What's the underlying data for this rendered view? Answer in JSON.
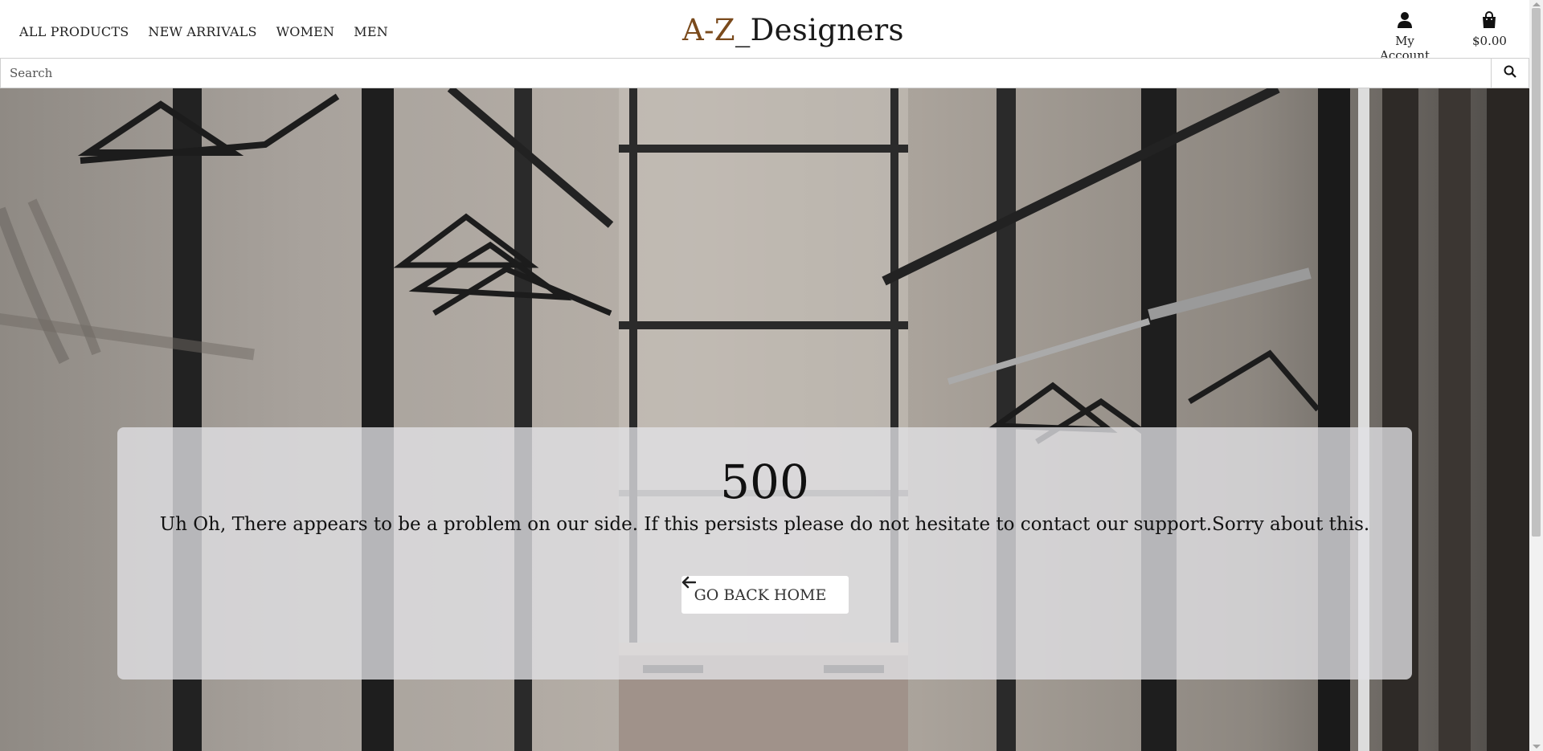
{
  "nav": {
    "items": [
      "ALL PRODUCTS",
      "NEW ARRIVALS",
      "WOMEN",
      "MEN"
    ]
  },
  "brand": {
    "part1": "A-Z",
    "part2": "_Designers"
  },
  "account": {
    "label": "My Account",
    "icon": "user-icon"
  },
  "cart": {
    "total": "$0.00",
    "icon": "shopping-bag-icon"
  },
  "search": {
    "placeholder": "Search",
    "value": "",
    "icon": "search-icon"
  },
  "error": {
    "code": "500",
    "message": "Uh Oh, There appears to be a problem on our side. If this persists please do not hesitate to contact our support.Sorry about this.",
    "button_label": "GO BACK HOME",
    "button_icon": "arrow-left-icon"
  },
  "colors": {
    "brand_accent": "#7a4a1c",
    "panel_bg": "#e1e1e5"
  }
}
